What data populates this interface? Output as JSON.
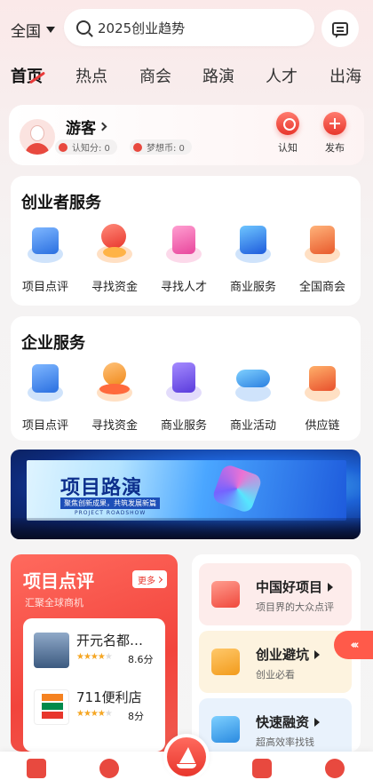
{
  "header": {
    "region": "全国",
    "search_placeholder": "2025创业趋势"
  },
  "tabs": [
    "首页",
    "热点",
    "商会",
    "路演",
    "人才",
    "出海"
  ],
  "user": {
    "name": "游客",
    "cognition_label": "认知分: 0",
    "dream_coin_label": "梦想币: 0",
    "actions": [
      "认知",
      "发布"
    ]
  },
  "founder_services": {
    "title": "创业者服务",
    "items": [
      "项目点评",
      "寻找资金",
      "寻找人才",
      "商业服务",
      "全国商会"
    ]
  },
  "enterprise_services": {
    "title": "企业服务",
    "items": [
      "项目点评",
      "寻找资金",
      "商业服务",
      "商业活动",
      "供应链"
    ]
  },
  "banner": {
    "title": "项目路演",
    "subtitle": "聚焦创新成果，共筑发展新篇",
    "english": "PROJECT ROADSHOW"
  },
  "review_card": {
    "title": "项目点评",
    "subtitle": "汇聚全球商机",
    "more": "更多",
    "projects": [
      {
        "name": "开元名都…",
        "rating": 4,
        "score": "8.6分"
      },
      {
        "name": "711便利店",
        "rating": 4,
        "score": "8分"
      }
    ]
  },
  "side_cards": [
    {
      "title": "中国好项目",
      "desc": "项目界的大众点评"
    },
    {
      "title": "创业避坑",
      "desc": "创业必看"
    },
    {
      "title": "快速融资",
      "desc": "超高效率找钱"
    }
  ],
  "colors": {
    "accent": "#e8362c",
    "card_pink": "#fdeceb",
    "card_yellow": "#fdf3df",
    "card_blue": "#e9f2fc"
  }
}
